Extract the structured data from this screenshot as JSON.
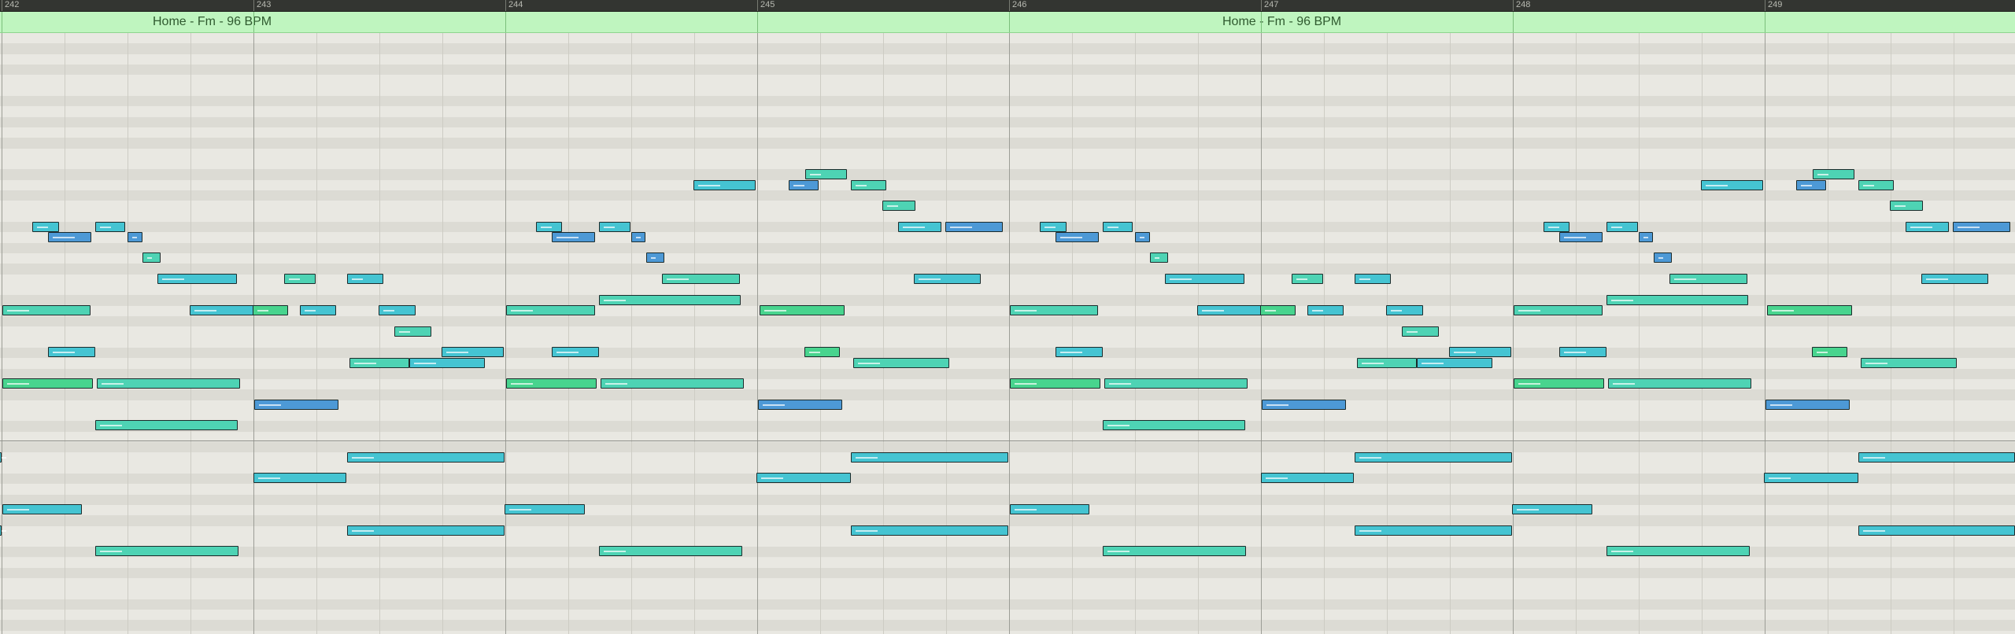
{
  "ruler": {
    "bars": [
      "242",
      "243",
      "244",
      "245",
      "246",
      "247",
      "248",
      "249"
    ]
  },
  "markers": [
    {
      "label": "Home - Fm - 96 BPM"
    },
    {
      "label": "Home - Fm - 96 BPM"
    }
  ],
  "colors": {
    "ruler_bg": "#333531",
    "marker_bg": "#bff5bf",
    "marker_text": "#2f5a2f",
    "note_teal": "#45c4d2",
    "note_green": "#48d48e",
    "note_mint": "#4ed3b4",
    "note_blue": "#4d99d6",
    "note_border": "#1c2b2b"
  }
}
